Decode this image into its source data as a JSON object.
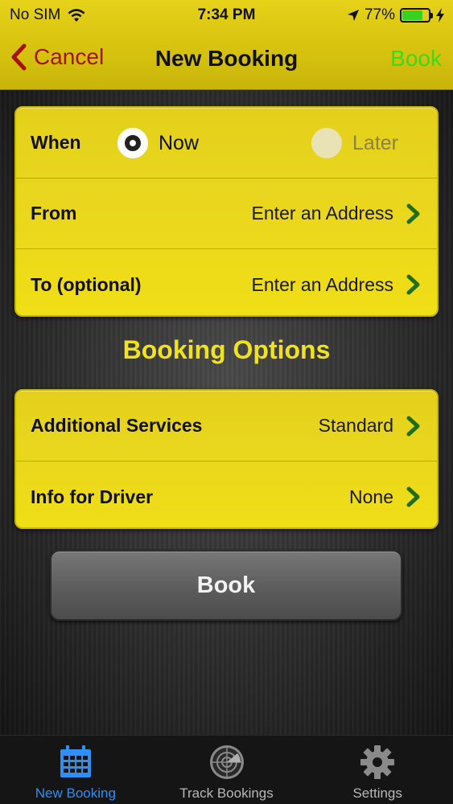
{
  "status_bar": {
    "carrier": "No SIM",
    "time": "7:34 PM",
    "battery": "77%",
    "battery_level": 0.77
  },
  "nav": {
    "cancel_label": "Cancel",
    "title": "New Booking",
    "book_label": "Book"
  },
  "trip": {
    "when": {
      "label": "When",
      "options": [
        {
          "label": "Now",
          "selected": true
        },
        {
          "label": "Later",
          "selected": false
        }
      ]
    },
    "from": {
      "label": "From",
      "value": "Enter an Address"
    },
    "to": {
      "label": "To (optional)",
      "value": "Enter an Address"
    }
  },
  "options_section": {
    "title": "Booking Options",
    "rows": [
      {
        "label": "Additional Services",
        "value": "Standard"
      },
      {
        "label": "Info for Driver",
        "value": "None"
      }
    ]
  },
  "book_button_label": "Book",
  "tabs": [
    {
      "label": "New Booking",
      "icon": "calendar-icon",
      "active": true
    },
    {
      "label": "Track Bookings",
      "icon": "radar-icon",
      "active": false
    },
    {
      "label": "Settings",
      "icon": "gear-icon",
      "active": false
    }
  ],
  "colors": {
    "header_yellow": "#e0cc14",
    "card_yellow": "#ecd91c",
    "cancel_red": "#a8120e",
    "book_green": "#31e01a",
    "section_title": "#f0e31c",
    "tab_active_blue": "#2f8ff5",
    "battery_green": "#39d11f"
  }
}
